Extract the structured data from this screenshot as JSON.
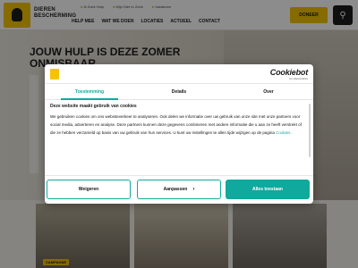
{
  "header": {
    "logo_line1": "DIEREN",
    "logo_line2": "BESCHERMING",
    "toplinks": [
      "Ik Zoek Hulp",
      "Mijn Dier In Zoek",
      "Vacatures"
    ],
    "nav": [
      "HELP MEE",
      "WAT WE DOEN",
      "LOCATIES",
      "ACTUEEL",
      "CONTACT"
    ],
    "donate_label": "DONEER",
    "search_icon": "search-icon"
  },
  "hero": {
    "title": "JOUW HULP IS DEZE ZOMER ONMISBAAR"
  },
  "cards": {
    "tag": "CAMPAGNE"
  },
  "cookie_dialog": {
    "brand": "Cookiebot",
    "brand_by": "by Usercentrics",
    "tabs": [
      "Toestemming",
      "Details",
      "Over"
    ],
    "title": "Deze website maakt gebruik van cookies",
    "body": "We gebruiken cookies om ons websiteverkeer te analyseren. Ook delen we informatie over uw gebruik van onze site met onze partners voor social media, adverteren en analyse. Deze partners kunnen deze gegevens combineren met andere informatie die u aan ze heeft verstrekt of die ze hebben verzameld op basis van uw gebruik van hun services. U kunt uw instellingen te allen tijde wijzigen op de pagina",
    "link": "Cookies",
    "buttons": {
      "deny": "Weigeren",
      "customize": "Aanpassen",
      "allow": "Alles toestaan"
    },
    "accent_color": "#10a99e"
  }
}
